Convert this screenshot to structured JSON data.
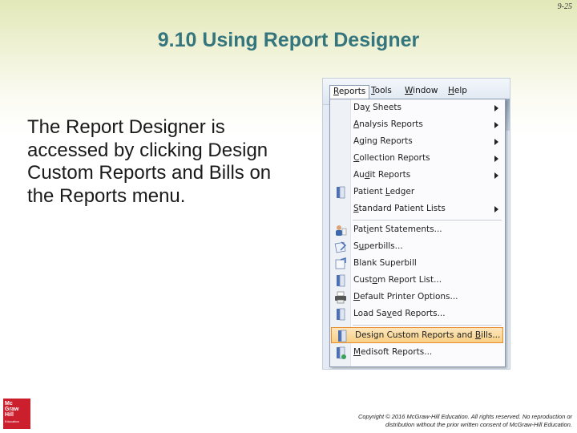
{
  "slide": {
    "number": "9-25",
    "title": "9.10 Using Report Designer",
    "body": "The Report Designer is accessed by clicking Design Custom Reports and Bills on the Reports menu."
  },
  "menubar": {
    "items": [
      {
        "pre": "",
        "key": "R",
        "post": "eports",
        "active": true
      },
      {
        "pre": "",
        "key": "T",
        "post": "ools",
        "active": false
      },
      {
        "pre": "",
        "key": "W",
        "post": "indow",
        "active": false
      },
      {
        "pre": "",
        "key": "H",
        "post": "elp",
        "active": false
      }
    ]
  },
  "reports_menu": {
    "items": [
      {
        "pre": "Da",
        "key": "y",
        "post": " Sheets",
        "submenu": true,
        "icon": "none"
      },
      {
        "pre": "",
        "key": "A",
        "post": "nalysis Reports",
        "submenu": true,
        "icon": "none"
      },
      {
        "pre": "A",
        "key": "g",
        "post": "ing Reports",
        "submenu": true,
        "icon": "none"
      },
      {
        "pre": "",
        "key": "C",
        "post": "ollection Reports",
        "submenu": true,
        "icon": "none"
      },
      {
        "pre": "Au",
        "key": "d",
        "post": "it Reports",
        "submenu": true,
        "icon": "none"
      },
      {
        "pre": "Patient ",
        "key": "L",
        "post": "edger",
        "submenu": false,
        "icon": "report-book-icon"
      },
      {
        "pre": "",
        "key": "S",
        "post": "tandard Patient Lists",
        "submenu": true,
        "icon": "none"
      },
      {
        "pre": "Pat",
        "key": "i",
        "post": "ent Statements...",
        "submenu": false,
        "icon": "patient-statement-icon"
      },
      {
        "pre": "S",
        "key": "u",
        "post": "perbills...",
        "submenu": false,
        "icon": "superbill-icon"
      },
      {
        "pre": "Blank Superbill",
        "key": "",
        "post": "",
        "submenu": false,
        "icon": "blank-superbill-icon"
      },
      {
        "pre": "Cust",
        "key": "o",
        "post": "m Report List...",
        "submenu": false,
        "icon": "custom-report-list-icon"
      },
      {
        "pre": "",
        "key": "D",
        "post": "efault Printer Options...",
        "submenu": false,
        "icon": "printer-icon"
      },
      {
        "pre": "Load Sa",
        "key": "v",
        "post": "ed Reports...",
        "submenu": false,
        "icon": "saved-reports-icon"
      },
      {
        "pre": "Design Custom Reports and ",
        "key": "B",
        "post": "ills...",
        "submenu": false,
        "icon": "design-reports-icon",
        "highlighted": true
      },
      {
        "pre": "",
        "key": "M",
        "post": "edisoft Reports...",
        "submenu": false,
        "icon": "medisoft-reports-icon"
      }
    ]
  },
  "footer": {
    "logo_lines": [
      "Mc",
      "Graw",
      "Hill",
      "Education"
    ],
    "copyright_line1": "Copyright © 2016 McGraw-Hill Education. All rights reserved. No reproduction or",
    "copyright_line2": "distribution without the prior written consent of McGraw-Hill Education."
  },
  "colors": {
    "title": "#35757e",
    "highlight_border": "#e98a2b",
    "logo": "#cc1f2d"
  }
}
